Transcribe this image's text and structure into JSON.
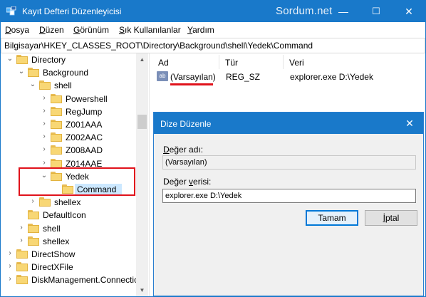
{
  "window": {
    "title": "Kayıt Defteri Düzenleyicisi",
    "watermark": "Sordum.net",
    "controls": {
      "minimize": "—",
      "maximize": "☐",
      "close": "✕"
    }
  },
  "menu": {
    "items": [
      {
        "pre": "",
        "ul": "D",
        "rest": "osya"
      },
      {
        "pre": "",
        "ul": "D",
        "rest": "üzen"
      },
      {
        "pre": "",
        "ul": "G",
        "rest": "örünüm"
      },
      {
        "pre": "",
        "ul": "S",
        "rest": "ık Kullanılanlar"
      },
      {
        "pre": "",
        "ul": "Y",
        "rest": "ardım"
      }
    ]
  },
  "address": "Bilgisayar\\HKEY_CLASSES_ROOT\\Directory\\Background\\shell\\Yedek\\Command",
  "tree": {
    "items": [
      {
        "label": "Directory",
        "chev": "⌄"
      },
      {
        "label": "Background",
        "chev": "⌄"
      },
      {
        "label": "shell",
        "chev": "⌄"
      },
      {
        "label": "Powershell",
        "chev": "›"
      },
      {
        "label": "RegJump",
        "chev": "›"
      },
      {
        "label": "Z001AAA",
        "chev": "›"
      },
      {
        "label": "Z002AAC",
        "chev": "›"
      },
      {
        "label": "Z008AAD",
        "chev": "›"
      },
      {
        "label": "Z014AAE",
        "chev": "›"
      },
      {
        "label": "Yedek",
        "chev": "⌄"
      },
      {
        "label": "Command",
        "chev": ""
      },
      {
        "label": "shellex",
        "chev": "›"
      },
      {
        "label": "DefaultIcon",
        "chev": ""
      },
      {
        "label": "shell",
        "chev": "›"
      },
      {
        "label": "shellex",
        "chev": "›"
      },
      {
        "label": "DirectShow",
        "chev": "›"
      },
      {
        "label": "DirectXFile",
        "chev": "›"
      },
      {
        "label": "DiskManagement.Connectio",
        "chev": "›"
      }
    ],
    "selected": "Command",
    "scroll_up": "▲",
    "scroll_down": "▼"
  },
  "list": {
    "headers": {
      "name": "Ad",
      "type": "Tür",
      "data": "Veri"
    },
    "rows": [
      {
        "icon": "ab",
        "name": "(Varsayılan)",
        "type": "REG_SZ",
        "data": "explorer.exe D:\\Yedek"
      }
    ]
  },
  "dialog": {
    "title": "Dize Düzenle",
    "close": "✕",
    "name_label_ul": "D",
    "name_label_rest": "eğer adı:",
    "name_value": "(Varsayılan)",
    "data_label_pre": "Değer ",
    "data_label_ul": "v",
    "data_label_rest": "erisi:",
    "data_value": "explorer.exe D:\\Yedek",
    "ok": "Tamam",
    "cancel_ul": "İ",
    "cancel_rest": "ptal"
  },
  "colors": {
    "titlebar": "#1979ca",
    "highlight": "#e0121b",
    "selection": "#cce8ff",
    "folder": "#f8d775"
  }
}
